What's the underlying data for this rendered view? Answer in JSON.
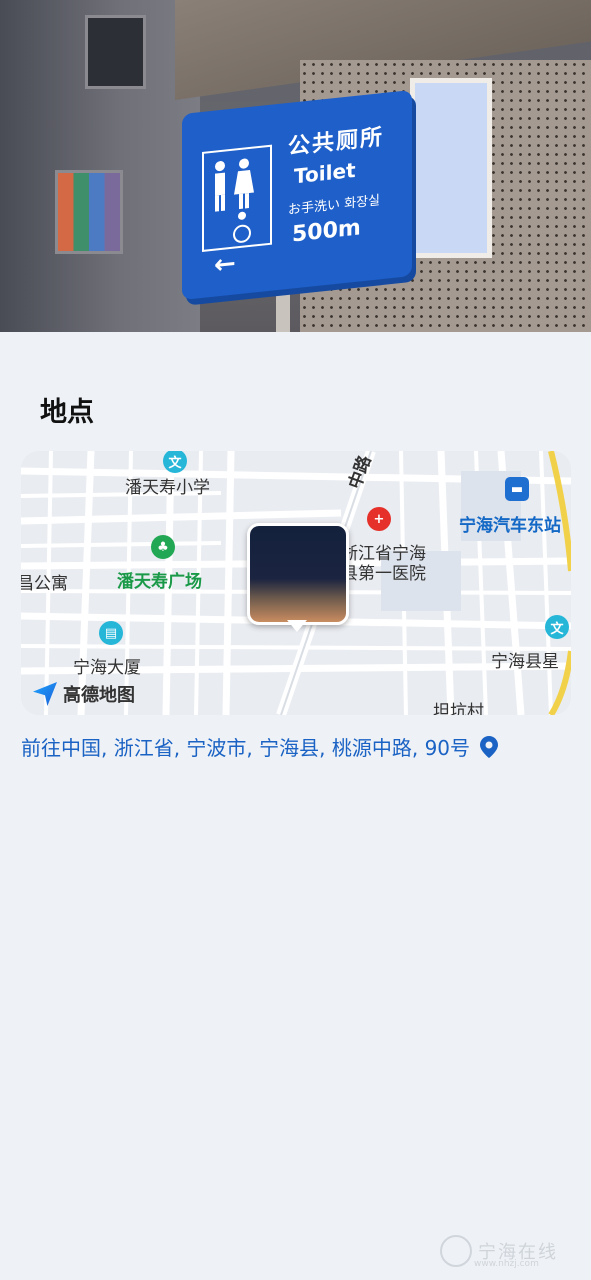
{
  "photo": {
    "sign": {
      "title": "公共厕所",
      "english": "Toilet",
      "subtitle": "お手洗い 화장실",
      "distance": "500m",
      "arrow": "←"
    }
  },
  "section": {
    "title": "地点"
  },
  "map": {
    "labels": {
      "school": "潘天寿小学",
      "plaza": "潘天寿广场",
      "apartment": "昌公寓",
      "hospital_line1": "浙江省宁海",
      "hospital_line2": "县第一医院",
      "station": "宁海汽车东站",
      "tower": "宁海大厦",
      "county": "宁海县星",
      "village": "坦坑村",
      "road": "中路"
    },
    "logo": "高德地图"
  },
  "address": {
    "text": "前往中国, 浙江省, 宁波市, 宁海县, 桃源中路, 90号",
    "icon": "location-pin-icon"
  },
  "watermark": {
    "text": "宁海在线",
    "sub": "www.nhzj.com"
  },
  "colors": {
    "background": "#eef2f6",
    "link": "#1a62c4",
    "sign_blue": "#1e5fc9"
  }
}
